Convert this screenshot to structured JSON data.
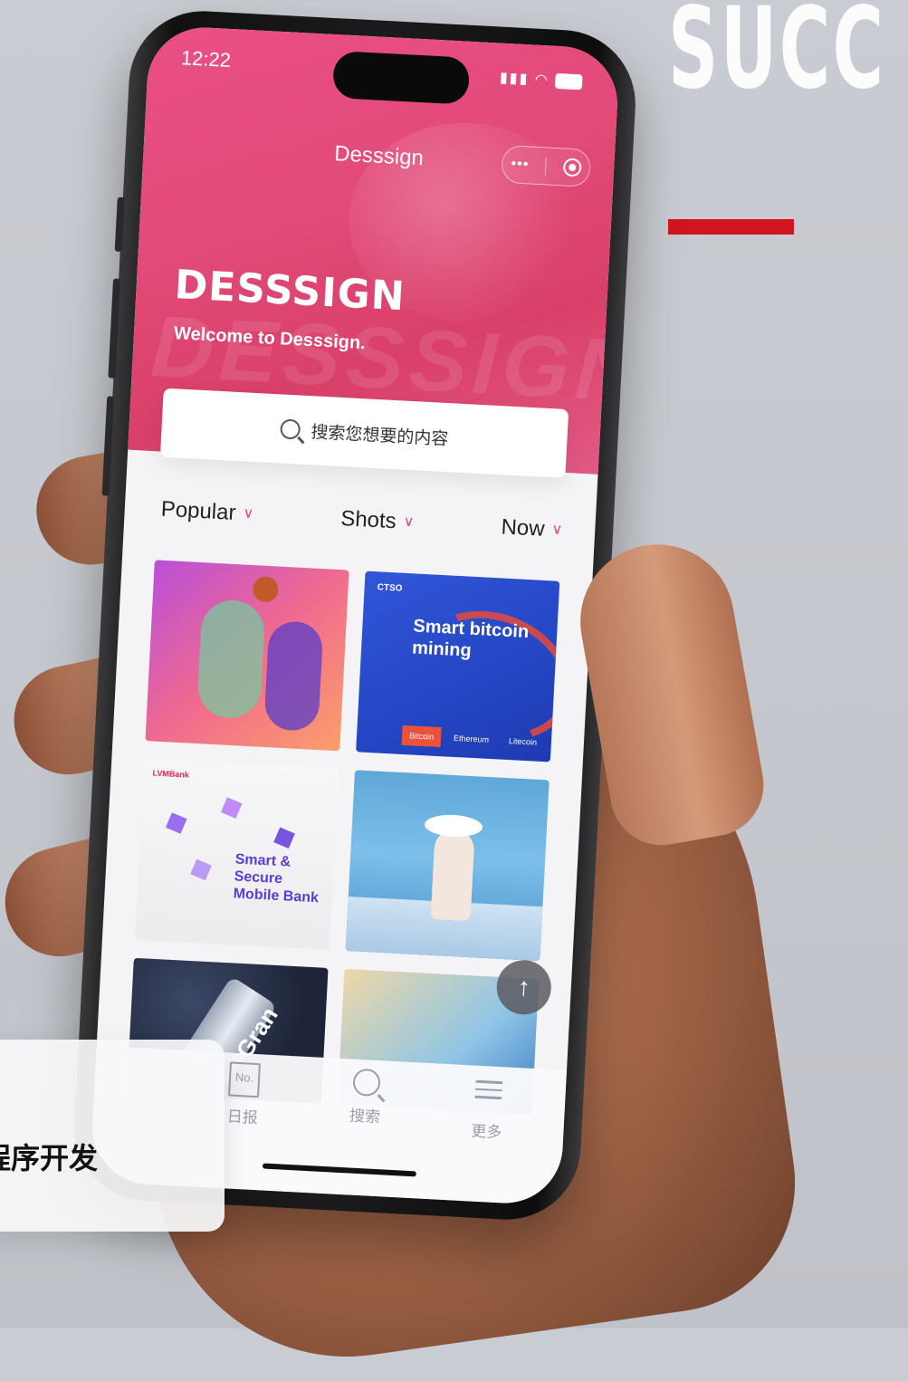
{
  "backdrop": {
    "headline": "SUCC",
    "accent_color": "#d0161f"
  },
  "phone": {
    "status": {
      "time": "12:22",
      "signal": "signal-icon",
      "wifi": "wifi-icon",
      "battery": "battery-icon"
    },
    "nav": {
      "title": "Desssign",
      "more_icon": "more-dots-icon",
      "close_icon": "target-icon"
    },
    "hero": {
      "brand": "DESSSIGN",
      "welcome": "Welcome to Desssign.",
      "ghost_word": "DESSSIGN",
      "color": "#e24a78"
    },
    "search": {
      "placeholder": "搜索您想要的内容",
      "icon": "search-icon"
    },
    "filters": [
      {
        "label": "Popular"
      },
      {
        "label": "Shots"
      },
      {
        "label": "Now"
      }
    ],
    "cards": [
      {
        "name": "basketball-illustration"
      },
      {
        "name": "smart-bitcoin-mining",
        "logo": "CTSO",
        "headline_line1": "Smart bitcoin",
        "headline_line2": "mining",
        "tabs": [
          "Bitcoin",
          "Ethereum",
          "Litecoin"
        ]
      },
      {
        "name": "mobile-bank",
        "logo": "LVMBank",
        "headline_line1": "Smart & Secure",
        "headline_line2": "Mobile Bank"
      },
      {
        "name": "beach-illustration"
      },
      {
        "name": "bottle-shot",
        "label": "Gran"
      },
      {
        "name": "weather-illustration"
      }
    ],
    "fab_icon": "arrow-up-icon",
    "tabbar": [
      {
        "label": "日报",
        "icon": "daily-report-icon",
        "icon_text": "No."
      },
      {
        "label": "搜索",
        "icon": "search-icon"
      },
      {
        "label": "更多",
        "icon": "menu-icon"
      }
    ]
  },
  "caption": {
    "text": "程序开发"
  }
}
